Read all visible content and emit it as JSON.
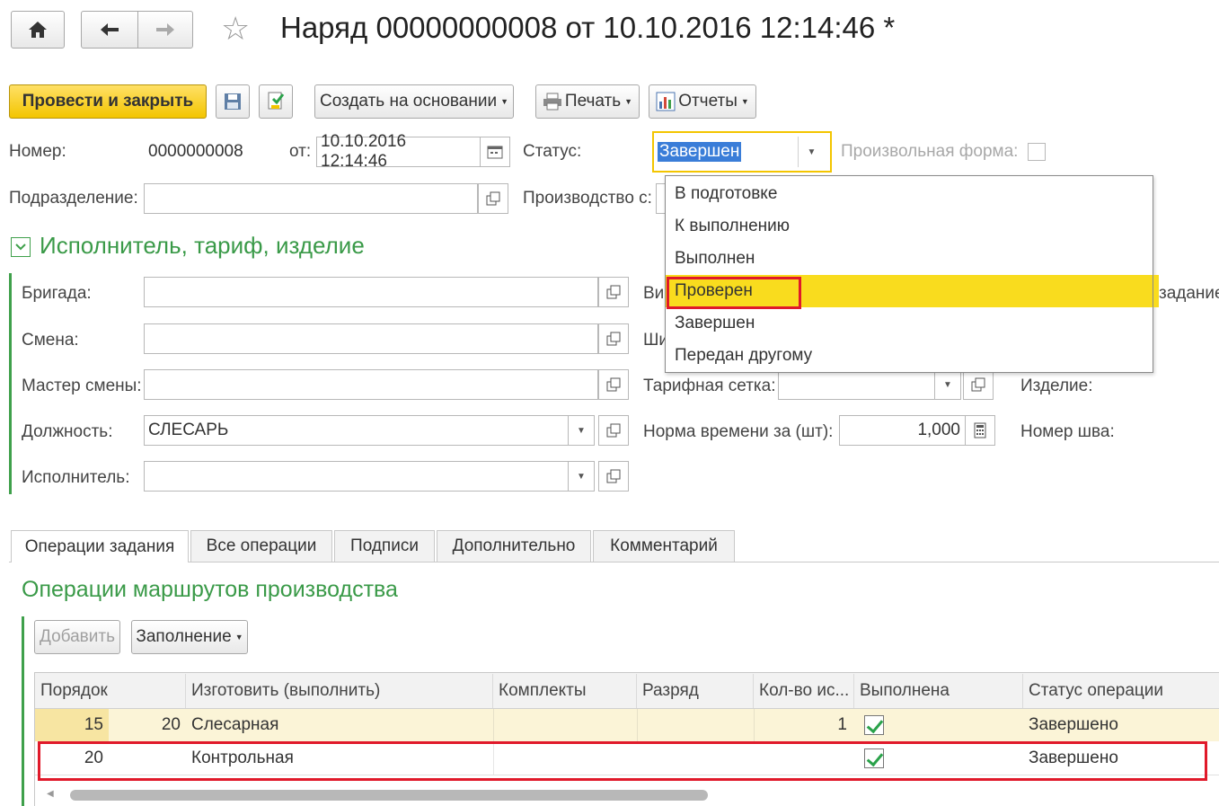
{
  "window": {
    "title": "Наряд 00000000008 от 10.10.2016 12:14:46 *"
  },
  "toolbar": {
    "post_and_close": "Провести и закрыть",
    "create_based_on": "Создать на основании",
    "print": "Печать",
    "reports": "Отчеты"
  },
  "header": {
    "number_label": "Номер:",
    "number_value": "0000000008",
    "date_label": "от:",
    "date_value": "10.10.2016 12:14:46",
    "status_label": "Статус:",
    "status_value": "Завершен",
    "free_form_label": "Произвольная форма:",
    "division_label": "Подразделение:",
    "division_value": "",
    "production_label": "Производство с:"
  },
  "status_dropdown": {
    "options": [
      "В подготовке",
      "К выполнению",
      "Выполнен",
      "Проверен",
      "Завершен",
      "Передан другому"
    ],
    "highlighted": "Проверен",
    "highlight_color": "#f9dc1e"
  },
  "section_executor": {
    "title": "Исполнитель, тариф, изделие",
    "brigade_label": "Бригада:",
    "shift_label": "Смена:",
    "shift_master_label": "Мастер смены:",
    "position_label": "Должность:",
    "position_value": "СЛЕСАРЬ",
    "executor_label": "Исполнитель:",
    "kind_label_partial": "Ви",
    "width_label_partial": "Ши",
    "task_label_partial": "задание",
    "tariff_grid_label": "Тарифная сетка:",
    "time_norm_label": "Норма времени за (шт):",
    "time_norm_value": "1,000",
    "product_label": "Изделие:",
    "seam_number_label": "Номер шва:"
  },
  "tabs": [
    {
      "label": "Операции задания",
      "active": true
    },
    {
      "label": "Все операции",
      "active": false
    },
    {
      "label": "Подписи",
      "active": false
    },
    {
      "label": "Дополнительно",
      "active": false
    },
    {
      "label": "Комментарий",
      "active": false
    }
  ],
  "operations": {
    "title": "Операции маршрутов производства",
    "add_button": "Добавить",
    "fill_button": "Заполнение",
    "columns": [
      "Порядок",
      "Изготовить (выполнить)",
      "Комплекты",
      "Разряд",
      "Кол-во ис...",
      "Выполнена",
      "Статус операции"
    ],
    "rows": [
      {
        "order": "15",
        "sub": "20",
        "name": "Слесарная",
        "sets": "",
        "rank": "",
        "qty": "1",
        "done": true,
        "status": "Завершено"
      },
      {
        "order": "20",
        "sub": "",
        "name": "Контрольная",
        "sets": "",
        "rank": "",
        "qty": "",
        "done": true,
        "status": "Завершено"
      }
    ]
  },
  "colors": {
    "accent_green": "#3fa04b",
    "primary_yellow": "#f3c500",
    "annotation_red": "#e0192a"
  }
}
